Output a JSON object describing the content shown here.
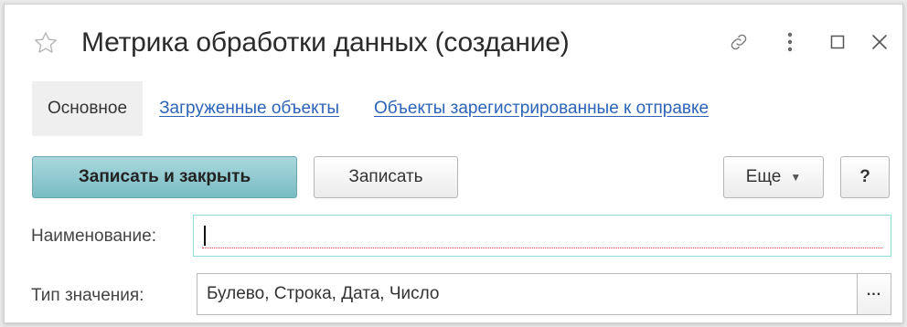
{
  "window": {
    "title": "Метрика обработки данных (создание)",
    "icons": [
      "star-icon",
      "link-icon",
      "more-vertical-icon",
      "maximize-icon",
      "close-icon"
    ]
  },
  "tabs": {
    "active": "Основное",
    "links": [
      "Загруженные объекты",
      "Объекты зарегистрированные к отправке"
    ]
  },
  "toolbar": {
    "save_close_label": "Записать и закрыть",
    "save_label": "Записать",
    "more_label": "Еще",
    "help_label": "?"
  },
  "form": {
    "name_label": "Наименование:",
    "name_value": "",
    "type_label": "Тип значения:",
    "type_value": "Булево, Строка, Дата, Число",
    "choose_label": "..."
  },
  "colors": {
    "primary_button": "#79bcc3",
    "link": "#2c63b9",
    "focus_border": "#8fdcd4",
    "required_underline": "#e23b3b"
  }
}
